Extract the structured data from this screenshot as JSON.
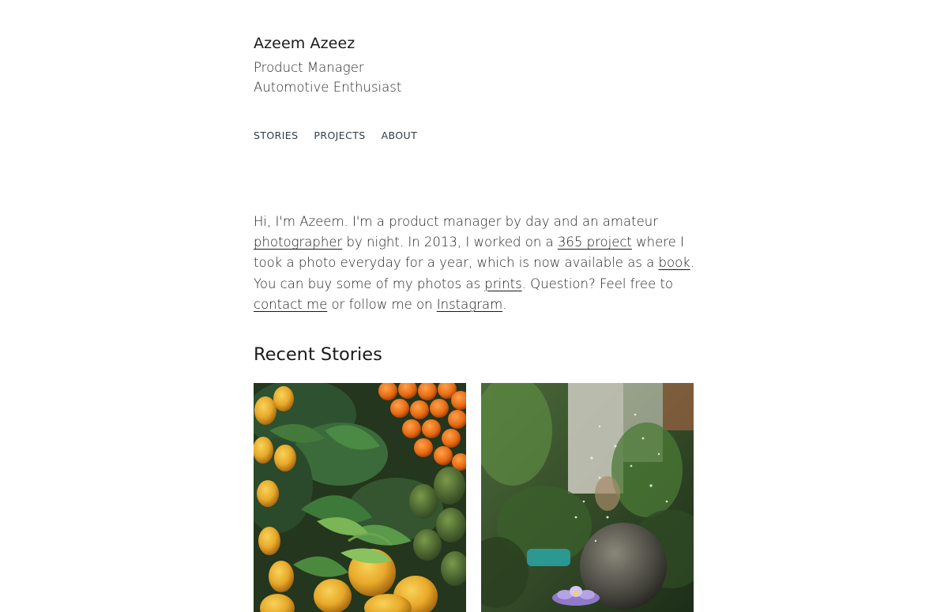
{
  "header": {
    "name": "Azeem Azeez",
    "tagline_1": "Product Manager",
    "tagline_2": "Automotive Enthusiast"
  },
  "nav": {
    "items": [
      {
        "label": "STORIES"
      },
      {
        "label": "PROJECTS"
      },
      {
        "label": "ABOUT"
      }
    ]
  },
  "intro": {
    "p1": "Hi, I'm Azeem. I'm a product manager by day and an amateur ",
    "link_photographer": "photographer",
    "p2": " by night. In 2013, I worked on a ",
    "link_365": "365 project",
    "p3": " where I took a photo everyday for a year, which is now available as a ",
    "link_book": "book",
    "p4": ". You can buy some of my photos as ",
    "link_prints": "prints",
    "p5": ". Question? Feel free to ",
    "link_contact": "contact me",
    "p6": " or follow me on ",
    "link_instagram": "Instagram",
    "p7": "."
  },
  "recent": {
    "title": "Recent Stories"
  },
  "colors": {
    "nav_text": "#2f3d47",
    "body_text": "#262626"
  }
}
